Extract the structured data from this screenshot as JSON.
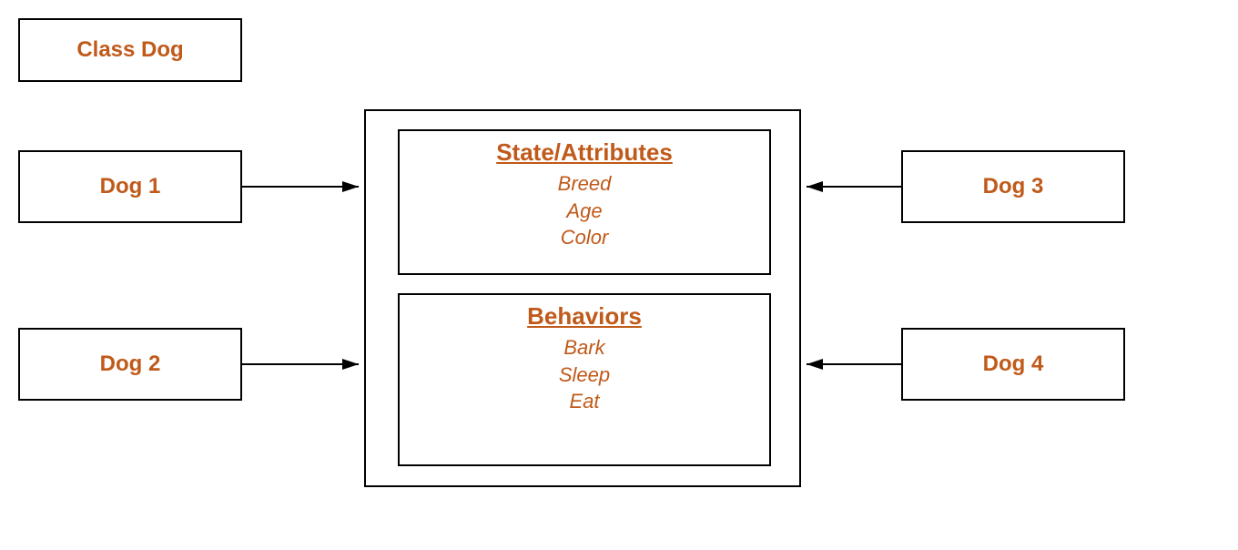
{
  "classLabel": "Class Dog",
  "instances": {
    "dog1": "Dog 1",
    "dog2": "Dog 2",
    "dog3": "Dog 3",
    "dog4": "Dog 4"
  },
  "attributes": {
    "title": "State/Attributes",
    "items": [
      "Breed",
      "Age",
      "Color"
    ]
  },
  "behaviors": {
    "title": "Behaviors",
    "items": [
      "Bark",
      "Sleep",
      "Eat"
    ]
  }
}
